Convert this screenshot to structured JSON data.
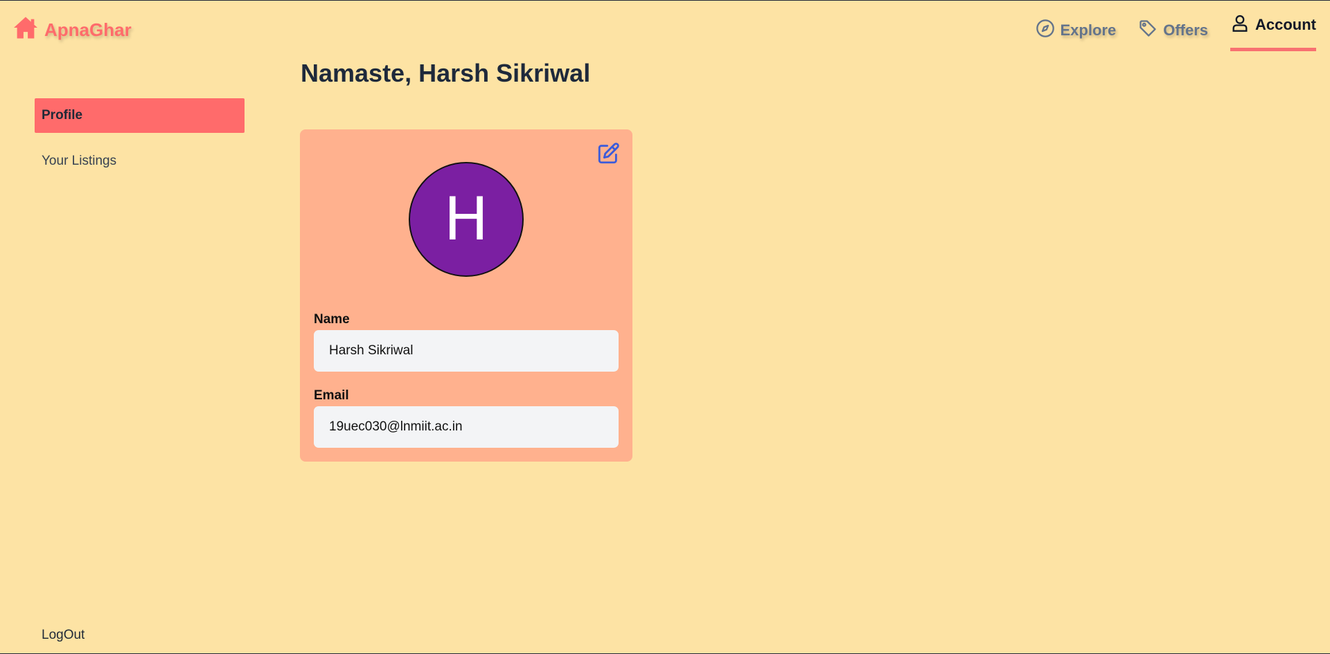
{
  "header": {
    "brand": "ApnaGhar",
    "nav": [
      {
        "label": "Explore",
        "icon": "compass-icon"
      },
      {
        "label": "Offers",
        "icon": "tag-icon"
      },
      {
        "label": "Account",
        "icon": "user-icon",
        "active": true
      }
    ]
  },
  "sidebar": {
    "items": [
      {
        "label": "Profile",
        "active": true
      },
      {
        "label": "Your Listings"
      }
    ],
    "logout_label": "LogOut"
  },
  "main": {
    "greeting": "Namaste, Harsh Sikriwal",
    "profile": {
      "avatar_letter": "H",
      "name_label": "Name",
      "name_value": "Harsh Sikriwal",
      "email_label": "Email",
      "email_value": "19uec030@lnmiit.ac.in"
    }
  },
  "colors": {
    "background": "#fde3a4",
    "brand": "#ff6b6b",
    "card": "#ffb18e",
    "avatar": "#7b1fa2",
    "accent": "#3b5bdb"
  }
}
